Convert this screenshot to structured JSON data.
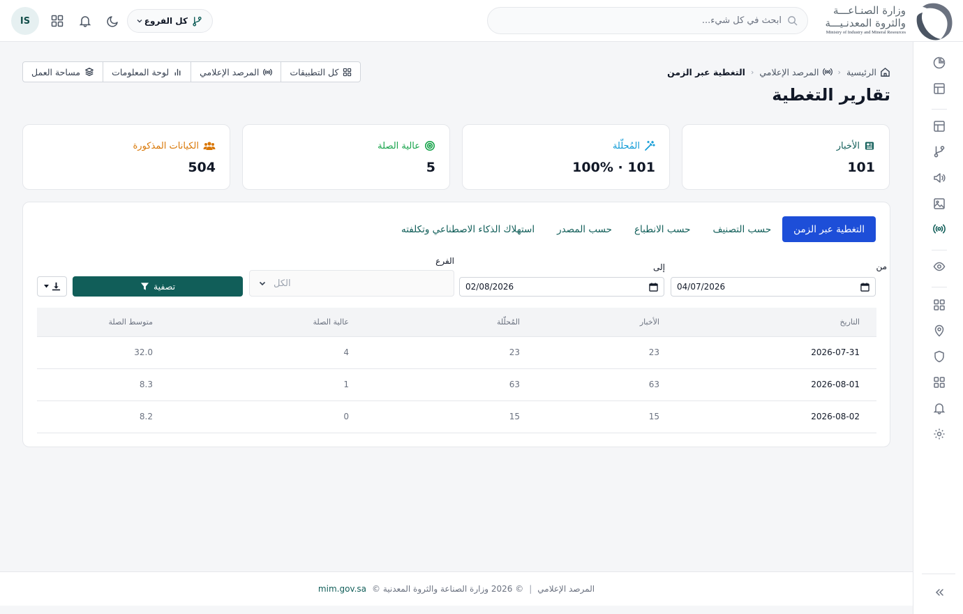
{
  "header": {
    "avatar_initials": "IS",
    "branch_selector_label": "كل الفروع",
    "search_placeholder": "ابحث في كل شيء...",
    "logo_line1": "وزارة الصنـاعـــة",
    "logo_line2": "والثروة المعدنـيـــة",
    "logo_en": "Ministry of Industry and Mineral Resources"
  },
  "breadcrumb": {
    "home": "الرئيسية",
    "section": "المرصد الإعلامي",
    "current": "التغطية عبر الزمن"
  },
  "page_title": "تقارير التغطية",
  "quick_links": {
    "all_apps": "كل التطبيقات",
    "media_observatory": "المرصد الإعلامي",
    "dashboard": "لوحة المعلومات",
    "workspace": "مساحة العمل"
  },
  "stats": {
    "news": {
      "label": "الأخبار",
      "value": "101",
      "color": "#115e59"
    },
    "analyzed": {
      "label": "المُحلّلة",
      "value": "101 · 100%",
      "color": "#0e9ad6"
    },
    "high_relevance": {
      "label": "عالية الصلة",
      "value": "5",
      "color": "#16a34a"
    },
    "entities": {
      "label": "الكيانات المذكورة",
      "value": "504",
      "color": "#d97706"
    }
  },
  "tabs": [
    {
      "label": "التغطية عبر الزمن",
      "active": true
    },
    {
      "label": "حسب التصنيف",
      "active": false
    },
    {
      "label": "حسب الانطباع",
      "active": false
    },
    {
      "label": "حسب المصدر",
      "active": false
    },
    {
      "label": "استهلاك الذكاء الاصطناعي وتكلفته",
      "active": false
    }
  ],
  "filters": {
    "from_label": "من",
    "from_value": "04/07/2026",
    "to_label": "إلى",
    "to_value": "02/08/2026",
    "branch_label": "الفرع",
    "branch_value": "الكل",
    "filter_button": "تصفية"
  },
  "table": {
    "headers": {
      "date": "التاريخ",
      "news": "الأخبار",
      "analyzed": "المُحلّلة",
      "high_relevance": "عالية الصلة",
      "avg_relevance": "متوسط الصلة"
    },
    "rows": [
      {
        "date": "2026-07-31",
        "news": "23",
        "analyzed": "23",
        "high_relevance": "4",
        "avg_relevance": "32.0"
      },
      {
        "date": "2026-08-01",
        "news": "63",
        "analyzed": "63",
        "high_relevance": "1",
        "avg_relevance": "8.3"
      },
      {
        "date": "2026-08-02",
        "news": "15",
        "analyzed": "15",
        "high_relevance": "0",
        "avg_relevance": "8.2"
      }
    ]
  },
  "footer": {
    "section": "المرصد الإعلامي",
    "copyright": "© 2026 وزارة الصناعة والثروة المعدنية ©",
    "site": "mim.gov.sa"
  },
  "colors": {
    "primary": "#115e59",
    "active_tab": "#1d4ed8"
  }
}
